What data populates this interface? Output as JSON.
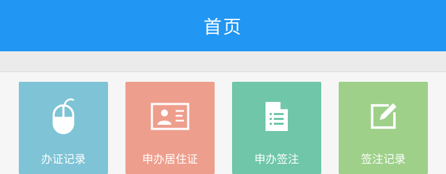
{
  "header": {
    "title": "首页",
    "color": "#2196f3"
  },
  "tiles": [
    {
      "label": "办证记录",
      "icon": "mouse-icon",
      "color": "#7ec3d6"
    },
    {
      "label": "申办居住证",
      "icon": "id-card-icon",
      "color": "#ee9e8c"
    },
    {
      "label": "申办签注",
      "icon": "document-icon",
      "color": "#6fc6a9"
    },
    {
      "label": "签注记录",
      "icon": "edit-icon",
      "color": "#9ed08a"
    }
  ]
}
